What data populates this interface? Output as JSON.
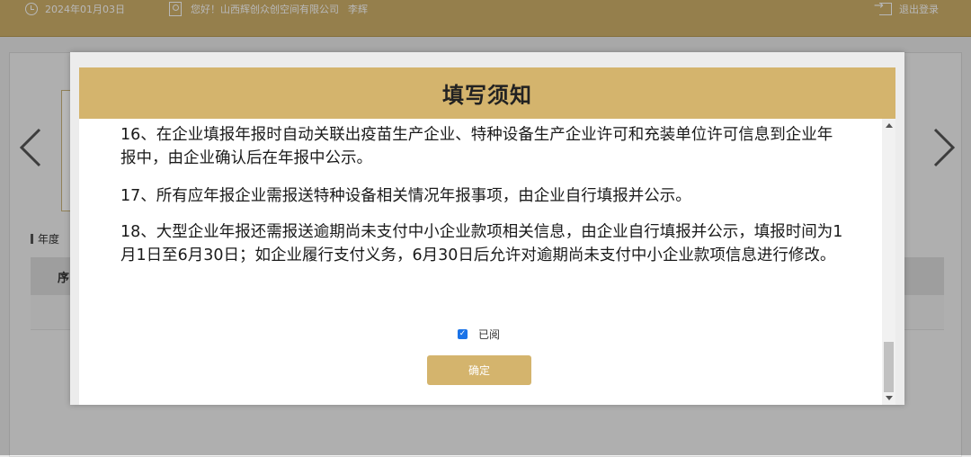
{
  "header": {
    "date": "2024年01月03日",
    "greeting": "您好！山西辉创众创空间有限公司",
    "user": "李辉",
    "logout_label": "退出登录"
  },
  "background": {
    "section_label": "年度",
    "table_first_col": "序"
  },
  "modal": {
    "title": "填写须知",
    "paragraphs": [
      "16、在企业填报年报时自动关联出疫苗生产企业、特种设备生产企业许可和充装单位许可信息到企业年报中，由企业确认后在年报中公示。",
      "17、所有应年报企业需报送特种设备相关情况年报事项，由企业自行填报并公示。",
      "18、大型企业年报还需报送逾期尚未支付中小企业款项相关信息，由企业自行填报并公示，填报时间为1月1日至6月30日；如企业履行支付义务，6月30日后允许对逾期尚未支付中小企业款项信息进行修改。"
    ],
    "checkbox_label": "已阅",
    "checkbox_checked": true,
    "confirm_label": "确定"
  },
  "colors": {
    "accent": "#d4b46d",
    "checkbox": "#1a73e8"
  }
}
